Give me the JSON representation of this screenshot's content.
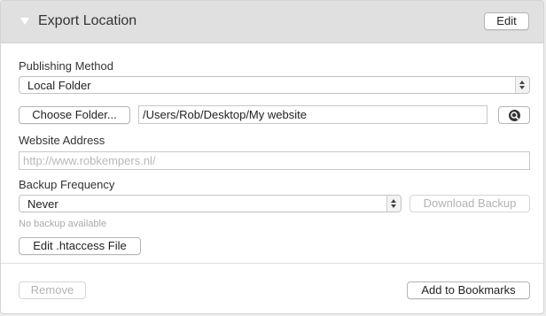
{
  "header": {
    "title": "Export Location",
    "edit_label": "Edit"
  },
  "publishing": {
    "label": "Publishing Method",
    "selected": "Local Folder"
  },
  "folder": {
    "choose_label": "Choose Folder...",
    "path": "/Users/Rob/Desktop/My website"
  },
  "website": {
    "label": "Website Address",
    "placeholder": "http://www.robkempers.nl/"
  },
  "backup": {
    "label": "Backup Frequency",
    "selected": "Never",
    "download_label": "Download Backup",
    "status": "No backup available"
  },
  "htaccess": {
    "edit_label": "Edit .htaccess File"
  },
  "footer": {
    "remove_label": "Remove",
    "bookmarks_label": "Add to Bookmarks"
  },
  "icons": {
    "disclosure": "triangle-down-icon",
    "search": "magnifier-icon",
    "select_arrows": "updown-chevron-icon"
  }
}
